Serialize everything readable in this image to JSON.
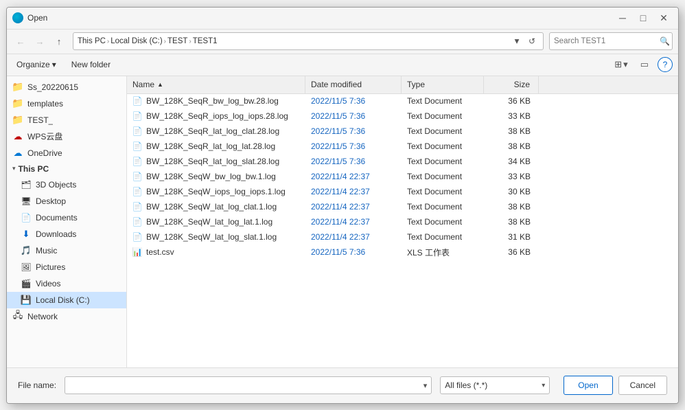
{
  "window": {
    "title": "Open",
    "close_label": "✕",
    "minimize_label": "─",
    "maximize_label": "□"
  },
  "nav": {
    "back_disabled": true,
    "forward_disabled": true,
    "up_label": "↑"
  },
  "address": {
    "segments": [
      "This PC",
      "Local Disk (C:)",
      "TEST",
      "TEST1"
    ],
    "arrows": [
      ">",
      ">",
      ">"
    ],
    "search_placeholder": "Search TEST1",
    "search_label": "Search"
  },
  "toolbar2": {
    "organize_label": "Organize",
    "new_folder_label": "New folder"
  },
  "sidebar": {
    "items": [
      {
        "id": "ss20220615",
        "label": "Ss_20220615",
        "icon": "folder",
        "selected": false
      },
      {
        "id": "templates",
        "label": "templates",
        "icon": "folder",
        "selected": false
      },
      {
        "id": "test",
        "label": "TEST_",
        "icon": "folder",
        "selected": false
      },
      {
        "id": "wpscloud",
        "label": "WPS云盘",
        "icon": "cloud",
        "selected": false
      },
      {
        "id": "onedrive",
        "label": "OneDrive",
        "icon": "onedrive",
        "selected": false
      },
      {
        "id": "thispc",
        "label": "This PC",
        "icon": "pc",
        "selected": false
      },
      {
        "id": "3dobjects",
        "label": "3D Objects",
        "icon": "3d",
        "selected": false
      },
      {
        "id": "desktop",
        "label": "Desktop",
        "icon": "desktop",
        "selected": false
      },
      {
        "id": "documents",
        "label": "Documents",
        "icon": "docs",
        "selected": false
      },
      {
        "id": "downloads",
        "label": "Downloads",
        "icon": "downloads",
        "selected": false
      },
      {
        "id": "music",
        "label": "Music",
        "icon": "music",
        "selected": false
      },
      {
        "id": "pictures",
        "label": "Pictures",
        "icon": "pictures",
        "selected": false
      },
      {
        "id": "videos",
        "label": "Videos",
        "icon": "videos",
        "selected": false
      },
      {
        "id": "localdisk",
        "label": "Local Disk (C:)",
        "icon": "disk",
        "selected": true
      },
      {
        "id": "network",
        "label": "Network",
        "icon": "network",
        "selected": false
      }
    ]
  },
  "file_list": {
    "columns": [
      {
        "id": "name",
        "label": "Name",
        "sort_arrow": "▲"
      },
      {
        "id": "modified",
        "label": "Date modified"
      },
      {
        "id": "type",
        "label": "Type"
      },
      {
        "id": "size",
        "label": "Size"
      }
    ],
    "files": [
      {
        "name": "BW_128K_SeqR_bw_log_bw.28.log",
        "modified": "2022/11/5 7:36",
        "type": "Text Document",
        "size": "36 KB",
        "icon": "txt"
      },
      {
        "name": "BW_128K_SeqR_iops_log_iops.28.log",
        "modified": "2022/11/5 7:36",
        "type": "Text Document",
        "size": "33 KB",
        "icon": "txt"
      },
      {
        "name": "BW_128K_SeqR_lat_log_clat.28.log",
        "modified": "2022/11/5 7:36",
        "type": "Text Document",
        "size": "38 KB",
        "icon": "txt"
      },
      {
        "name": "BW_128K_SeqR_lat_log_lat.28.log",
        "modified": "2022/11/5 7:36",
        "type": "Text Document",
        "size": "38 KB",
        "icon": "txt"
      },
      {
        "name": "BW_128K_SeqR_lat_log_slat.28.log",
        "modified": "2022/11/5 7:36",
        "type": "Text Document",
        "size": "34 KB",
        "icon": "txt"
      },
      {
        "name": "BW_128K_SeqW_bw_log_bw.1.log",
        "modified": "2022/11/4 22:37",
        "type": "Text Document",
        "size": "33 KB",
        "icon": "txt"
      },
      {
        "name": "BW_128K_SeqW_iops_log_iops.1.log",
        "modified": "2022/11/4 22:37",
        "type": "Text Document",
        "size": "30 KB",
        "icon": "txt"
      },
      {
        "name": "BW_128K_SeqW_lat_log_clat.1.log",
        "modified": "2022/11/4 22:37",
        "type": "Text Document",
        "size": "38 KB",
        "icon": "txt"
      },
      {
        "name": "BW_128K_SeqW_lat_log_lat.1.log",
        "modified": "2022/11/4 22:37",
        "type": "Text Document",
        "size": "38 KB",
        "icon": "txt"
      },
      {
        "name": "BW_128K_SeqW_lat_log_slat.1.log",
        "modified": "2022/11/4 22:37",
        "type": "Text Document",
        "size": "31 KB",
        "icon": "txt"
      },
      {
        "name": "test.csv",
        "modified": "2022/11/5 7:36",
        "type": "XLS 工作表",
        "size": "36 KB",
        "icon": "csv"
      }
    ]
  },
  "bottom": {
    "filename_label": "File name:",
    "filename_value": "",
    "filetype_label": "All files (*.*)",
    "open_label": "Open",
    "cancel_label": "Cancel"
  },
  "colors": {
    "accent": "#0066cc",
    "selected_bg": "#cce4ff",
    "hover_bg": "#e8f0fe"
  }
}
